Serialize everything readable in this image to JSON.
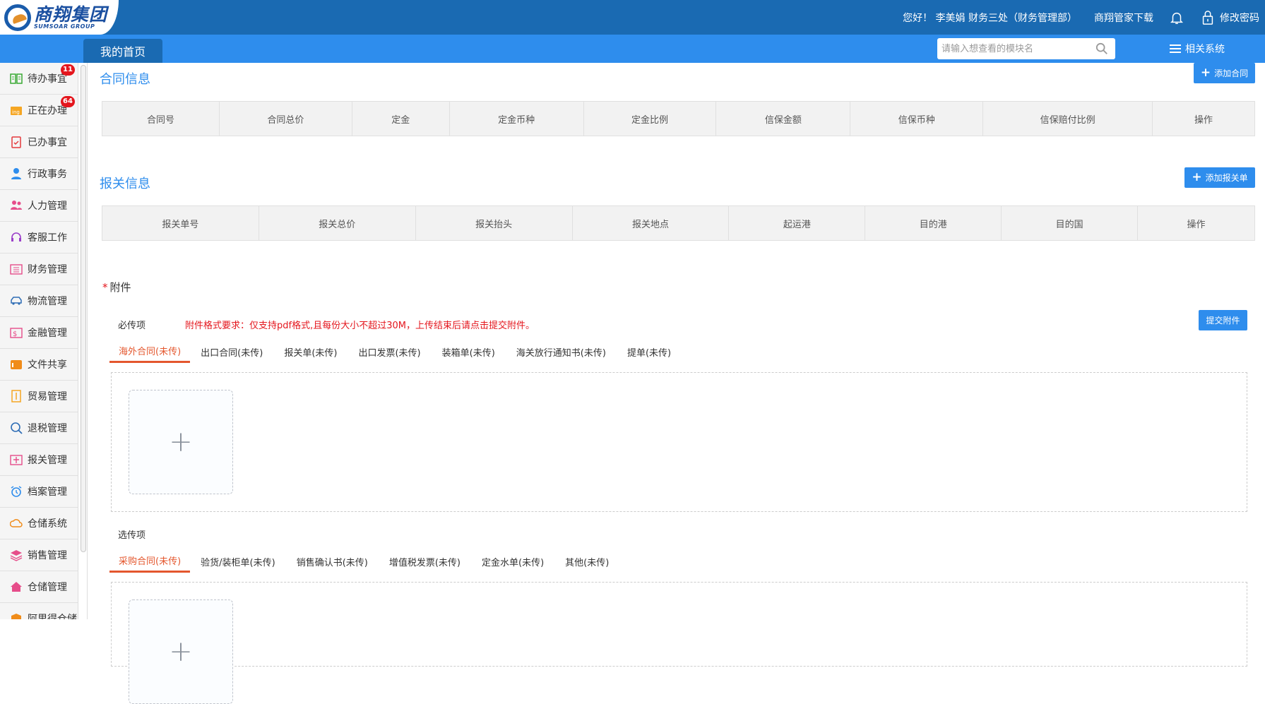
{
  "header": {
    "logo_cn": "商翔集团",
    "logo_en": "SUMSOAR GROUP",
    "greeting": "您好！ 李美娟 财务三处（财务管理部）",
    "app_download": "商翔管家下载",
    "change_password": "修改密码"
  },
  "nav": {
    "home_tab": "我的首页",
    "search_placeholder": "请输入想查看的模块名",
    "related_systems": "相关系统"
  },
  "sidebar": {
    "items": [
      {
        "label": "待办事宜",
        "icon": "book-icon",
        "badge": "11"
      },
      {
        "label": "正在办理",
        "icon": "ing-icon",
        "badge": "64"
      },
      {
        "label": "已办事宜",
        "icon": "clipboard-check-icon"
      },
      {
        "label": "行政事务",
        "icon": "person-icon"
      },
      {
        "label": "人力管理",
        "icon": "people-icon"
      },
      {
        "label": "客服工作",
        "icon": "headset-icon"
      },
      {
        "label": "财务管理",
        "icon": "finance-icon"
      },
      {
        "label": "物流管理",
        "icon": "car-icon"
      },
      {
        "label": "金融管理",
        "icon": "money-icon"
      },
      {
        "label": "文件共享",
        "icon": "folder-icon"
      },
      {
        "label": "贸易管理",
        "icon": "document-icon"
      },
      {
        "label": "退税管理",
        "icon": "tax-search-icon"
      },
      {
        "label": "报关管理",
        "icon": "customs-icon"
      },
      {
        "label": "档案管理",
        "icon": "alarm-clock-icon"
      },
      {
        "label": "仓储系统",
        "icon": "warehouse-cloud-icon"
      },
      {
        "label": "销售管理",
        "icon": "layers-icon"
      },
      {
        "label": "仓储管理",
        "icon": "home-icon"
      },
      {
        "label": "阿里得仓储",
        "icon": "box-icon"
      }
    ]
  },
  "contract": {
    "title": "合同信息",
    "add_button": "添加合同",
    "columns": [
      "合同号",
      "合同总价",
      "定金",
      "定金币种",
      "定金比例",
      "信保金额",
      "信保币种",
      "信保赔付比例",
      "操作"
    ]
  },
  "customs": {
    "title": "报关信息",
    "add_button": "添加报关单",
    "columns": [
      "报关单号",
      "报关总价",
      "报关抬头",
      "报关地点",
      "起运港",
      "目的港",
      "目的国",
      "操作"
    ]
  },
  "attachments": {
    "title": "附件",
    "required_star": "*",
    "required_label": "必传项",
    "format_notice": "附件格式要求：仅支持pdf格式,且每份大小不超过30M，上传结束后请点击提交附件。",
    "submit_button": "提交附件",
    "required_tabs": [
      "海外合同(未传)",
      "出口合同(未传)",
      "报关单(未传)",
      "出口发票(未传)",
      "装箱单(未传)",
      "海关放行通知书(未传)",
      "提单(未传)"
    ],
    "optional_label": "选传项",
    "optional_tabs": [
      "采购合同(未传)",
      "验货/装柜单(未传)",
      "销售确认书(未传)",
      "增值税发票(未传)",
      "定金水单(未传)",
      "其他(未传)"
    ],
    "upload_plus": "+"
  }
}
